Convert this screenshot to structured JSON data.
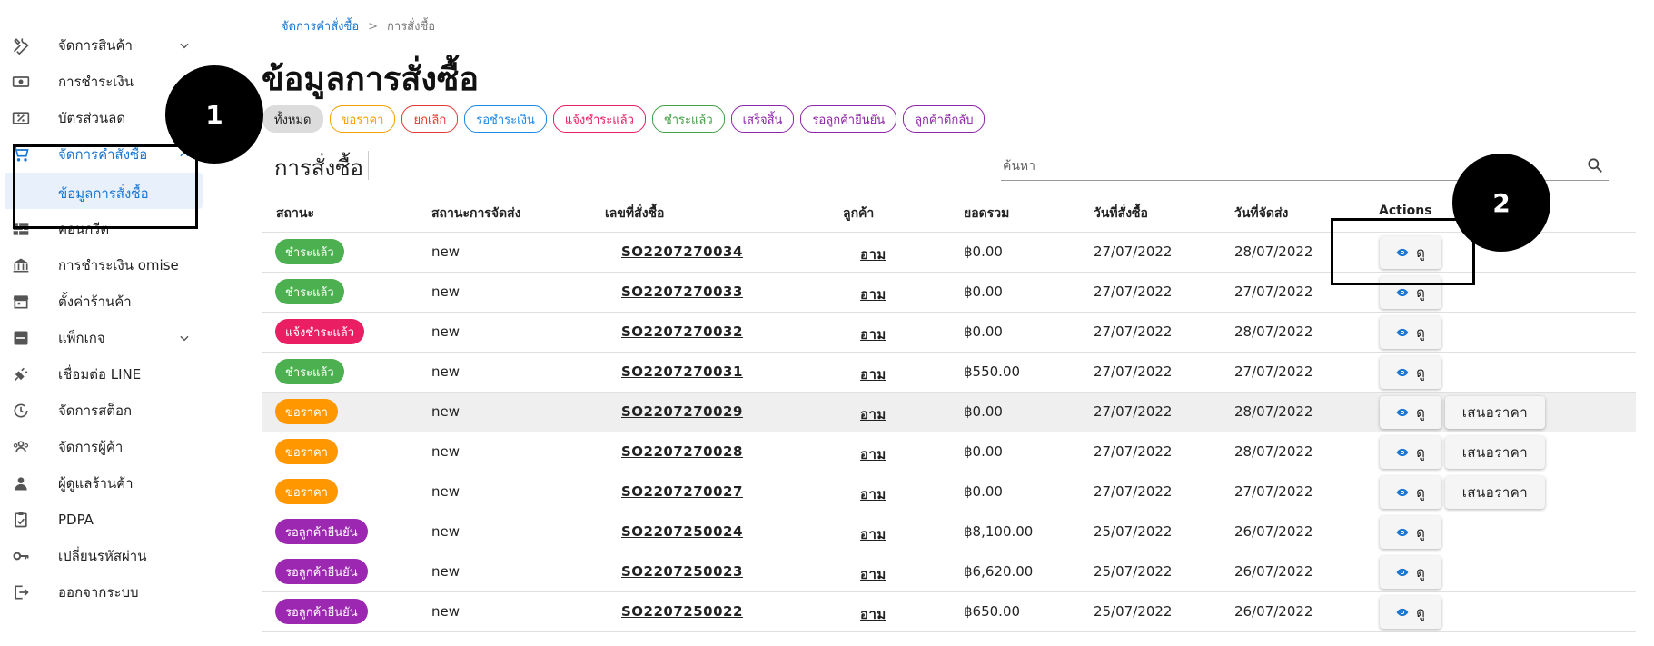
{
  "sidebar": {
    "items": [
      {
        "label": "จัดการสินค้า",
        "icon": "tools-icon",
        "expand": true
      },
      {
        "label": "การชำระเงิน",
        "icon": "money-icon"
      },
      {
        "label": "บัตรส่วนลด",
        "icon": "discount-icon"
      },
      {
        "label": "จัดการคำสั่งซื้อ",
        "icon": "cart-icon",
        "expand": true,
        "active": true
      },
      {
        "label": "คอนกรีต",
        "icon": "brick-icon"
      },
      {
        "label": "การชำระเงิน omise",
        "icon": "bank-icon"
      },
      {
        "label": "ตั้งค่าร้านค้า",
        "icon": "store-icon"
      },
      {
        "label": "แพ็กเกจ",
        "icon": "package-icon",
        "expand": true
      },
      {
        "label": "เชื่อมต่อ LINE",
        "icon": "plug-icon"
      },
      {
        "label": "จัดการสต็อก",
        "icon": "stock-icon"
      },
      {
        "label": "จัดการผู้ค้า",
        "icon": "group-icon"
      },
      {
        "label": "ผู้ดูแลร้านค้า",
        "icon": "person-icon"
      },
      {
        "label": "PDPA",
        "icon": "clipboard-icon"
      },
      {
        "label": "เปลี่ยนรหัสผ่าน",
        "icon": "key-icon"
      },
      {
        "label": "ออกจากระบบ",
        "icon": "logout-icon"
      }
    ],
    "sub_item": "ข้อมูลการสั่งซื้อ"
  },
  "breadcrumb": {
    "parent": "จัดการคำสั่งซื้อ",
    "separator": ">",
    "current": "การสั่งซื้อ"
  },
  "page_title": "ข้อมูลการสั่งซื้อ",
  "filters": [
    {
      "label": "ทั้งหมด",
      "color": "#222222"
    },
    {
      "label": "ขอราคา",
      "color": "#f5a000"
    },
    {
      "label": "ยกเลิก",
      "color": "#e53935"
    },
    {
      "label": "รอชำระเงิน",
      "color": "#1e88e5"
    },
    {
      "label": "แจ้งชำระแล้ว",
      "color": "#e91e63"
    },
    {
      "label": "ชำระแล้ว",
      "color": "#43a047"
    },
    {
      "label": "เสร็จสิ้น",
      "color": "#8e24aa"
    },
    {
      "label": "รอลูกค้ายืนยัน",
      "color": "#8e24aa"
    },
    {
      "label": "ลูกค้าตีกลับ",
      "color": "#8e24aa"
    }
  ],
  "section_title": "การสั่งซื้อ",
  "search": {
    "placeholder": "ค้นหา"
  },
  "table": {
    "columns": [
      "สถานะ",
      "สถานะการจัดส่ง",
      "เลขที่สั่งซื้อ",
      "ลูกค้า",
      "ยอดรวม",
      "วันที่สั่งซื้อ",
      "วันที่จัดส่ง",
      "Actions"
    ],
    "view_label": "ดู",
    "quote_label": "เสนอราคา",
    "rows": [
      {
        "status": "ชำระแล้ว",
        "status_color": "#4caf50",
        "shipping": "new",
        "order_no": "SO2207270034",
        "customer": "อาม",
        "total": "฿0.00",
        "order_date": "27/07/2022",
        "ship_date": "28/07/2022",
        "quote": false
      },
      {
        "status": "ชำระแล้ว",
        "status_color": "#4caf50",
        "shipping": "new",
        "order_no": "SO2207270033",
        "customer": "อาม",
        "total": "฿0.00",
        "order_date": "27/07/2022",
        "ship_date": "27/07/2022",
        "quote": false
      },
      {
        "status": "แจ้งชำระแล้ว",
        "status_color": "#e91e63",
        "shipping": "new",
        "order_no": "SO2207270032",
        "customer": "อาม",
        "total": "฿0.00",
        "order_date": "27/07/2022",
        "ship_date": "28/07/2022",
        "quote": false
      },
      {
        "status": "ชำระแล้ว",
        "status_color": "#4caf50",
        "shipping": "new",
        "order_no": "SO2207270031",
        "customer": "อาม",
        "total": "฿550.00",
        "order_date": "27/07/2022",
        "ship_date": "27/07/2022",
        "quote": false
      },
      {
        "status": "ขอราคา",
        "status_color": "#ff9800",
        "shipping": "new",
        "order_no": "SO2207270029",
        "customer": "อาม",
        "total": "฿0.00",
        "order_date": "27/07/2022",
        "ship_date": "28/07/2022",
        "quote": true,
        "highlight": true
      },
      {
        "status": "ขอราคา",
        "status_color": "#ff9800",
        "shipping": "new",
        "order_no": "SO2207270028",
        "customer": "อาม",
        "total": "฿0.00",
        "order_date": "27/07/2022",
        "ship_date": "28/07/2022",
        "quote": true
      },
      {
        "status": "ขอราคา",
        "status_color": "#ff9800",
        "shipping": "new",
        "order_no": "SO2207270027",
        "customer": "อาม",
        "total": "฿0.00",
        "order_date": "27/07/2022",
        "ship_date": "27/07/2022",
        "quote": true
      },
      {
        "status": "รอลูกค้ายืนยัน",
        "status_color": "#9c27b0",
        "shipping": "new",
        "order_no": "SO2207250024",
        "customer": "อาม",
        "total": "฿8,100.00",
        "order_date": "25/07/2022",
        "ship_date": "26/07/2022",
        "quote": false
      },
      {
        "status": "รอลูกค้ายืนยัน",
        "status_color": "#9c27b0",
        "shipping": "new",
        "order_no": "SO2207250023",
        "customer": "อาม",
        "total": "฿6,620.00",
        "order_date": "25/07/2022",
        "ship_date": "26/07/2022",
        "quote": false
      },
      {
        "status": "รอลูกค้ายืนยัน",
        "status_color": "#9c27b0",
        "shipping": "new",
        "order_no": "SO2207250022",
        "customer": "อาม",
        "total": "฿650.00",
        "order_date": "25/07/2022",
        "ship_date": "26/07/2022",
        "quote": false
      }
    ]
  },
  "annotations": [
    {
      "label": "1"
    },
    {
      "label": "2"
    }
  ],
  "colors": {
    "accent": "#1976d2",
    "active_bg": "#e8f1fb"
  }
}
